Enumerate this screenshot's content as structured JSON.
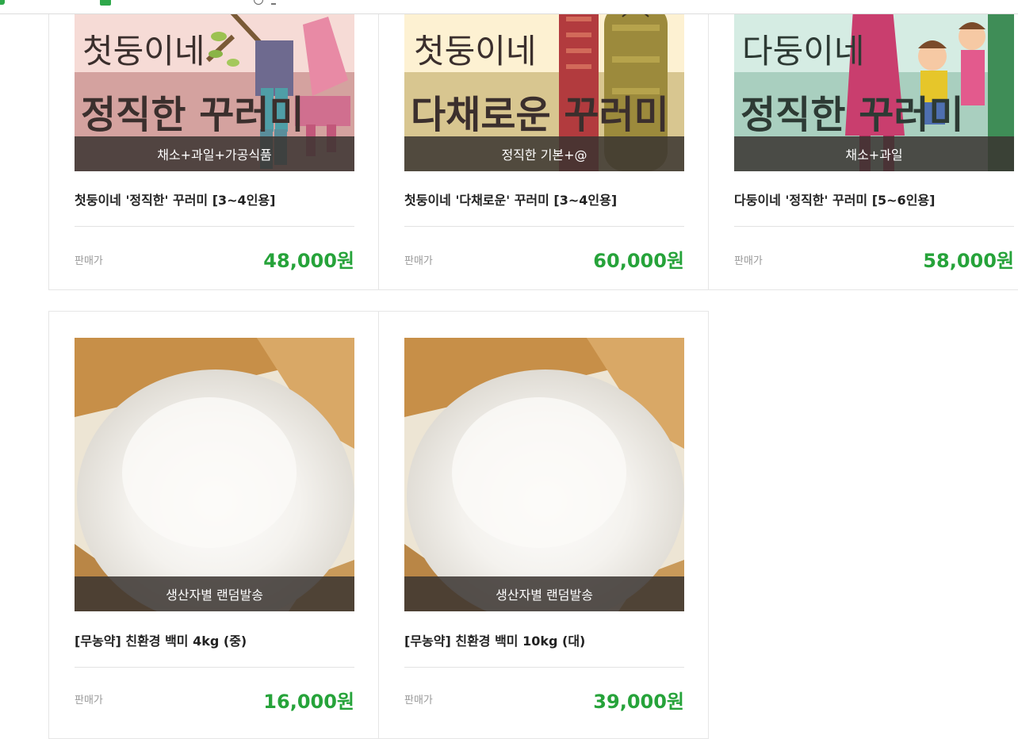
{
  "colors": {
    "price": "#26a33a",
    "caption_bg": "#3a3430"
  },
  "products": [
    {
      "title": "첫둥이네 '정직한' 꾸러미 [3~4인용]",
      "caption": "채소+과일+가공식품",
      "banner_small": "첫둥이네",
      "banner_big": "정직한 꾸러미",
      "price_label": "판매가",
      "price": "48,000원"
    },
    {
      "title": "첫둥이네 '다채로운' 꾸러미 [3~4인용]",
      "caption": "정직한 기본+@",
      "banner_small": "첫둥이네",
      "banner_big": "다채로운 꾸러미",
      "price_label": "판매가",
      "price": "60,000원"
    },
    {
      "title": "다둥이네 '정직한' 꾸러미 [5~6인용]",
      "caption": "채소+과일",
      "banner_small": "다둥이네",
      "banner_big": "정직한 꾸러미",
      "price_label": "판매가",
      "price": "58,000원"
    },
    {
      "title": "[무농약] 친환경 백미 4kg (중)",
      "caption": "생산자별 랜덤발송",
      "price_label": "판매가",
      "price": "16,000원"
    },
    {
      "title": "[무농약] 친환경 백미 10kg (대)",
      "caption": "생산자별 랜덤발송",
      "price_label": "판매가",
      "price": "39,000원"
    }
  ]
}
